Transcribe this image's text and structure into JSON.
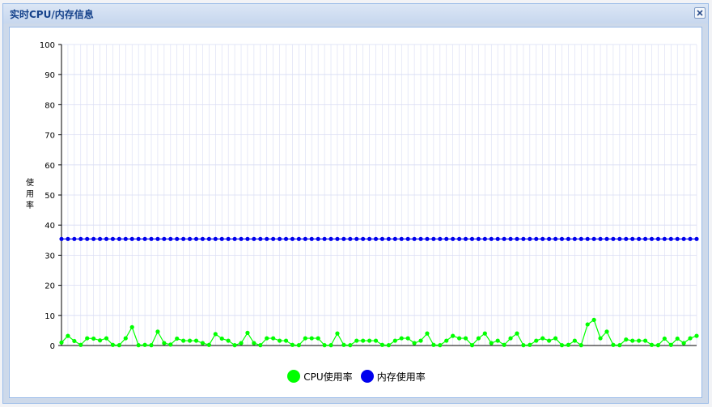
{
  "window": {
    "title": "实时CPU/内存信息"
  },
  "colors": {
    "cpu": "#00ff00",
    "memory": "#0000ee",
    "gridline": "#d8dcf4"
  },
  "chart_data": {
    "type": "line",
    "title": "",
    "xlabel": "",
    "ylabel": "使用率",
    "ylim": [
      0,
      100
    ],
    "yticks": [
      "0",
      "10",
      "20",
      "30",
      "40",
      "50",
      "60",
      "70",
      "80",
      "90",
      "100"
    ],
    "grid": true,
    "legend_position": "bottom-center",
    "series": [
      {
        "name": "CPU使用率",
        "color": "#00ff00",
        "values": [
          1.0,
          3.2,
          1.5,
          0.2,
          2.4,
          2.3,
          1.7,
          2.4,
          0.2,
          0.1,
          2.4,
          6.1,
          0.1,
          0.2,
          0.1,
          4.6,
          0.8,
          0.3,
          2.3,
          1.6,
          1.6,
          1.6,
          0.8,
          0.2,
          3.8,
          2.3,
          1.6,
          0.1,
          0.8,
          4.2,
          0.8,
          0.1,
          2.4,
          2.4,
          1.6,
          1.6,
          0.2,
          0.1,
          2.4,
          2.4,
          2.4,
          0.1,
          0.1,
          4.0,
          0.2,
          0.1,
          1.6,
          1.6,
          1.6,
          1.6,
          0.2,
          0.1,
          1.6,
          2.4,
          2.4,
          0.8,
          1.6,
          4.0,
          0.2,
          0.1,
          1.6,
          3.2,
          2.4,
          2.4,
          0.1,
          2.4,
          4.0,
          0.8,
          1.6,
          0.2,
          2.4,
          4.0,
          0.1,
          0.2,
          1.6,
          2.4,
          1.6,
          2.4,
          0.1,
          0.2,
          1.6,
          0.1,
          7.0,
          8.5,
          2.4,
          4.6,
          0.2,
          0.1,
          2.0,
          1.6,
          1.6,
          1.6,
          0.2,
          0.1,
          2.3,
          0.2,
          2.3,
          0.8,
          2.4,
          3.2
        ]
      },
      {
        "name": "内存使用率",
        "color": "#0000ee",
        "values": [
          35.4,
          35.4,
          35.4,
          35.4,
          35.4,
          35.4,
          35.4,
          35.4,
          35.4,
          35.4,
          35.4,
          35.4,
          35.4,
          35.4,
          35.4,
          35.4,
          35.4,
          35.4,
          35.4,
          35.4,
          35.4,
          35.4,
          35.4,
          35.4,
          35.4,
          35.4,
          35.4,
          35.4,
          35.4,
          35.4,
          35.4,
          35.4,
          35.4,
          35.4,
          35.4,
          35.4,
          35.4,
          35.4,
          35.4,
          35.4,
          35.4,
          35.4,
          35.4,
          35.4,
          35.4,
          35.4,
          35.4,
          35.4,
          35.4,
          35.4,
          35.4,
          35.4,
          35.4,
          35.4,
          35.4,
          35.4,
          35.4,
          35.4,
          35.4,
          35.4,
          35.4,
          35.4,
          35.4,
          35.4,
          35.4,
          35.4,
          35.4,
          35.4,
          35.4,
          35.4,
          35.4,
          35.4,
          35.4,
          35.4,
          35.4,
          35.4,
          35.4,
          35.4,
          35.4,
          35.4,
          35.4,
          35.4,
          35.4,
          35.4,
          35.4,
          35.4,
          35.4,
          35.4,
          35.4,
          35.4,
          35.4,
          35.4,
          35.4,
          35.4,
          35.4,
          35.4,
          35.4,
          35.4,
          35.4,
          35.4
        ]
      }
    ]
  }
}
